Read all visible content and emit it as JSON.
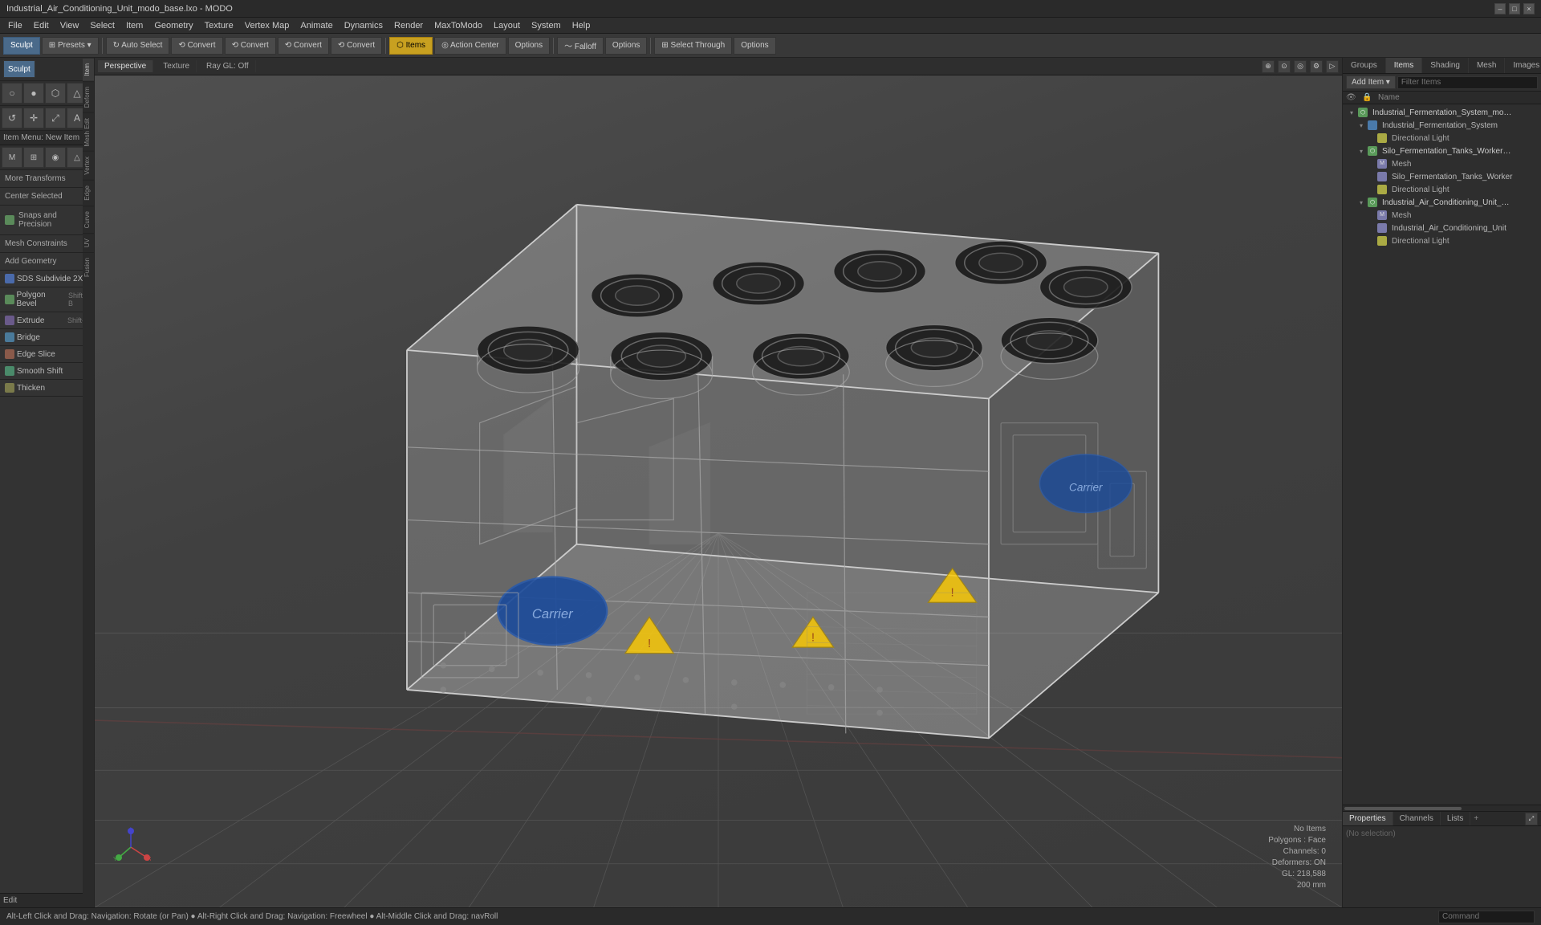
{
  "titlebar": {
    "title": "Industrial_Air_Conditioning_Unit_modo_base.lxo - MODO",
    "controls": [
      "–",
      "□",
      "×"
    ]
  },
  "menubar": {
    "items": [
      "File",
      "Edit",
      "View",
      "Select",
      "Item",
      "Geometry",
      "Texture",
      "Vertex Map",
      "Animate",
      "Dynamics",
      "Render",
      "MaxToModo",
      "Layout",
      "System",
      "Help"
    ]
  },
  "toolbar": {
    "sculpt_label": "Sculpt",
    "presets_label": "⊞ Presets",
    "buttons": [
      {
        "label": "↻ Auto Select",
        "active": false
      },
      {
        "label": "⟲ Convert",
        "active": false
      },
      {
        "label": "⟲ Convert",
        "active": false
      },
      {
        "label": "⟲ Convert",
        "active": false
      },
      {
        "label": "⟲ Convert",
        "active": false
      },
      {
        "label": "Items",
        "active": true
      },
      {
        "label": "Action Center",
        "active": false
      },
      {
        "label": "Options",
        "active": false
      },
      {
        "label": "Falloff",
        "active": false
      },
      {
        "label": "Options",
        "active": false
      },
      {
        "label": "⊞ Select Through",
        "active": false
      },
      {
        "label": "Options",
        "active": false
      }
    ]
  },
  "viewport": {
    "tabs": [
      "Perspective",
      "Texture",
      "Ray GL: Off"
    ],
    "icons": [
      "⊕",
      "⊙",
      "◎",
      "⚙",
      "▷"
    ],
    "status": {
      "no_items": "No Items",
      "polygons": "Polygons : Face",
      "channels": "Channels: 0",
      "deformers": "Deformers: ON",
      "gl_coords": "GL: 218,588",
      "zoom": "200 mm"
    }
  },
  "left_sidebar": {
    "sections": [
      {
        "name": "transforms",
        "label": "More Transforms",
        "items": []
      },
      {
        "name": "center",
        "label": "Center Selected",
        "items": []
      },
      {
        "name": "snaps",
        "label": "Snaps and Precision",
        "items": []
      },
      {
        "name": "mesh_constraints",
        "label": "Mesh Constraints",
        "items": []
      },
      {
        "name": "add_geometry",
        "label": "Add Geometry",
        "items": []
      },
      {
        "name": "sds",
        "label": "SDS Subdivide 2X",
        "items": []
      },
      {
        "name": "polygon_bevel",
        "label": "Polygon Bevel",
        "shortcut": "Shift-B",
        "items": []
      },
      {
        "name": "extrude",
        "label": "Extrude",
        "shortcut": "Shift-X",
        "items": []
      },
      {
        "name": "bridge",
        "label": "Bridge",
        "items": []
      },
      {
        "name": "edge_slice",
        "label": "Edge Slice",
        "items": []
      },
      {
        "name": "smooth_shift",
        "label": "Smooth Shift",
        "items": []
      },
      {
        "name": "thicken",
        "label": "Thicken",
        "items": []
      }
    ],
    "edit_label": "Edit",
    "strip_tabs": [
      "Item",
      "Deform",
      "Mesh Edit",
      "Vertex",
      "Edge",
      "Curve",
      "UV",
      "Fusion"
    ]
  },
  "right_panel": {
    "tabs": [
      "Groups",
      "Items",
      "Shading",
      "Mesh",
      "Images"
    ],
    "active_tab": "Items",
    "items_toolbar": {
      "add_item_label": "Add Item",
      "filter_placeholder": "Filter Items"
    },
    "tree": [
      {
        "id": "fermentation_system_base",
        "label": "Industrial_Fermentation_System_modo_ba...",
        "type": "scene",
        "expanded": true,
        "visible": true,
        "children": [
          {
            "id": "fermentation_system",
            "label": "Industrial_Fermentation_System",
            "type": "mesh_group",
            "expanded": true,
            "visible": true,
            "children": [
              {
                "id": "directional_light_1",
                "label": "Directional Light",
                "type": "light",
                "visible": true
              }
            ]
          },
          {
            "id": "silo_tanks_base",
            "label": "Silo_Fermentation_Tanks_Worker_modo_b...",
            "type": "scene",
            "expanded": true,
            "visible": true,
            "children": [
              {
                "id": "silo_mesh",
                "label": "Mesh",
                "type": "mesh",
                "visible": true
              },
              {
                "id": "silo_tanks_worker",
                "label": "Silo_Fermentation_Tanks_Worker",
                "type": "mesh",
                "visible": true
              },
              {
                "id": "directional_light_2",
                "label": "Directional Light",
                "type": "light",
                "visible": true
              }
            ]
          },
          {
            "id": "air_conditioning_base",
            "label": "Industrial_Air_Conditioning_Unit_m...",
            "type": "scene",
            "expanded": true,
            "visible": true,
            "children": [
              {
                "id": "ac_mesh",
                "label": "Mesh",
                "type": "mesh",
                "visible": true
              },
              {
                "id": "ac_unit",
                "label": "Industrial_Air_Conditioning_Unit",
                "type": "mesh",
                "visible": true
              },
              {
                "id": "directional_light_3",
                "label": "Directional Light",
                "type": "light",
                "visible": true
              }
            ]
          }
        ]
      }
    ]
  },
  "properties": {
    "tabs": [
      "Properties",
      "Channels",
      "Lists"
    ],
    "active_tab": "Properties"
  },
  "status_bar": {
    "left": "Alt-Left Click and Drag: Navigation: Rotate (or Pan)  ●  Alt-Right Click and Drag: Navigation: Freewheel  ●  Alt-Middle Click and Drag: navRoll",
    "command_placeholder": "Command"
  }
}
